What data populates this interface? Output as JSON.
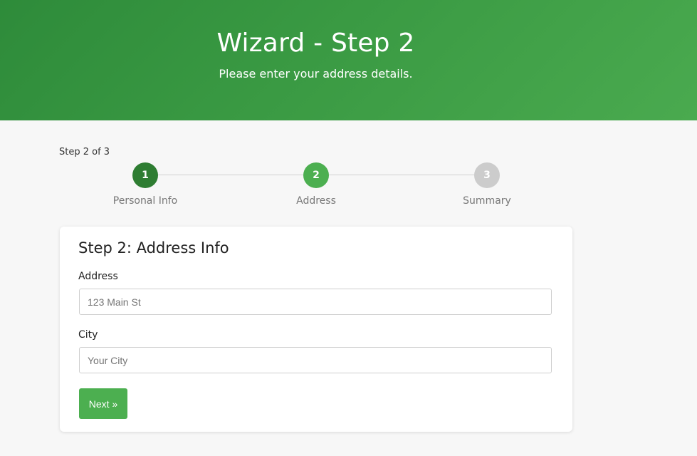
{
  "header": {
    "title": "Wizard - Step 2",
    "subtitle": "Please enter your address details."
  },
  "progress": {
    "counter": "Step 2 of 3",
    "steps": [
      {
        "number": "1",
        "label": "Personal Info",
        "state": "completed"
      },
      {
        "number": "2",
        "label": "Address",
        "state": "active"
      },
      {
        "number": "3",
        "label": "Summary",
        "state": "pending"
      }
    ]
  },
  "form": {
    "title": "Step 2: Address Info",
    "address": {
      "label": "Address",
      "placeholder": "123 Main St",
      "value": ""
    },
    "city": {
      "label": "City",
      "placeholder": "Your City",
      "value": ""
    },
    "next_label": "Next »"
  },
  "colors": {
    "accent": "#4caf50",
    "completed": "#2e7d32",
    "pending": "#cccccc"
  }
}
